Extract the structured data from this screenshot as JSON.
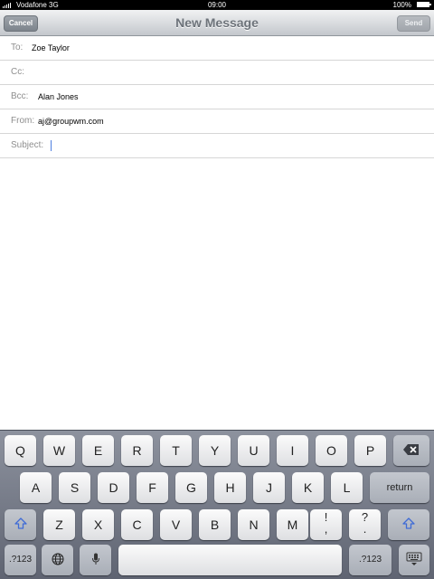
{
  "status_bar": {
    "carrier": "Vodafone 3G",
    "time": "09:00",
    "battery": "100%"
  },
  "nav": {
    "cancel_label": "Cancel",
    "title": "New Message",
    "send_label": "Send"
  },
  "fields": [
    {
      "label": "To:",
      "value": "Zoe Taylor"
    },
    {
      "label": "Cc:",
      "value": ""
    },
    {
      "label": "Bcc:",
      "value": "Alan Jones"
    },
    {
      "label": "From:",
      "value": "aj@groupwm.com"
    },
    {
      "label": "Subject:",
      "value": ""
    }
  ],
  "keyboard": {
    "row1": [
      "Q",
      "W",
      "E",
      "R",
      "T",
      "Y",
      "U",
      "I",
      "O",
      "P"
    ],
    "row2": [
      "A",
      "S",
      "D",
      "F",
      "G",
      "H",
      "J",
      "K",
      "L"
    ],
    "row3": [
      "Z",
      "X",
      "C",
      "V",
      "B",
      "N",
      "M"
    ],
    "return_label": "return",
    "numbers_label": ".?123",
    "exclaim_top": "!",
    "exclaim_bottom": ",",
    "question_top": "?",
    "question_bottom": ".",
    "icons": {
      "backspace": "backspace-icon",
      "shift": "shift-icon",
      "globe": "globe-icon",
      "mic": "microphone-icon",
      "dismiss": "keyboard-dismiss-icon"
    }
  }
}
